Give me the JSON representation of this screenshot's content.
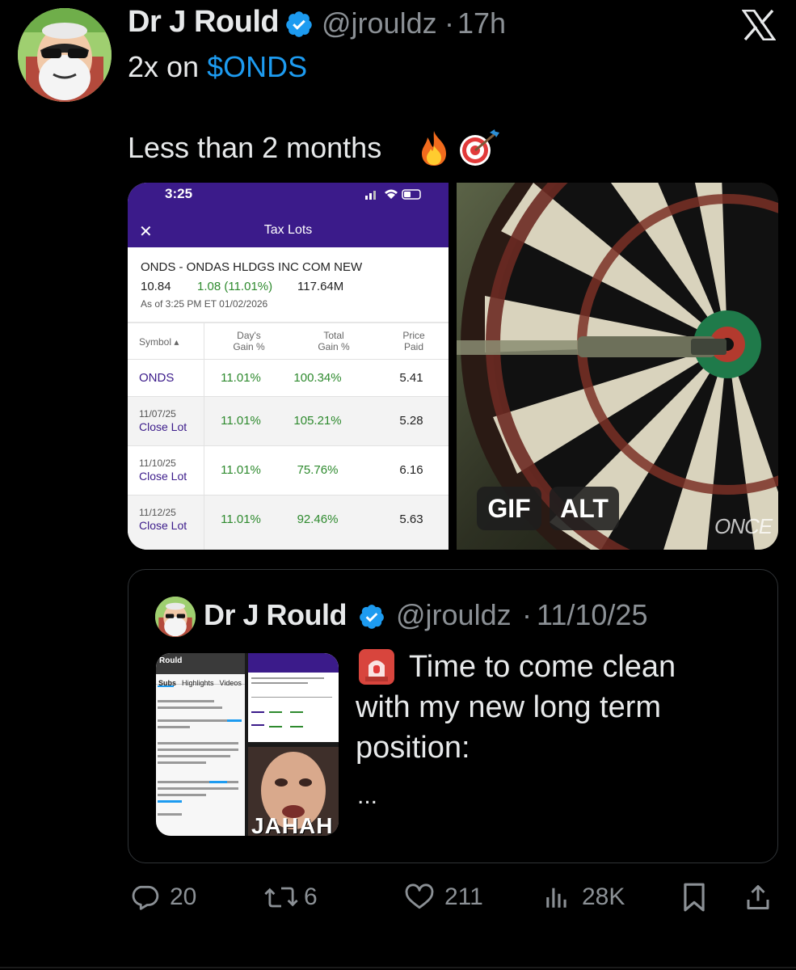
{
  "tweet": {
    "author_name": "Dr J Rould",
    "handle": "@jrouldz",
    "separator": "·",
    "time": "17h",
    "line1_prefix": "2x on ",
    "line1_cashtag": "$ONDS",
    "line2": "Less than 2 months"
  },
  "screenshot": {
    "status_time": "3:25",
    "title": "Tax Lots",
    "close_glyph": "✕",
    "security": "ONDS - ONDAS HLDGS INC COM NEW",
    "price": "10.84",
    "change": "1.08 (11.01%)",
    "volume": "117.64M",
    "as_of": "As of 3:25 PM ET 01/02/2026",
    "headers": {
      "symbol": "Symbol ▴",
      "days_gain_1": "Day's",
      "days_gain_2": "Gain %",
      "total_gain_1": "Total",
      "total_gain_2": "Gain %",
      "price_paid_1": "Price",
      "price_paid_2": "Paid"
    },
    "rows": [
      {
        "symbol": "ONDS",
        "day_gain": "11.01%",
        "total_gain": "100.34%",
        "price_paid": "5.41"
      },
      {
        "date": "11/07/25",
        "action": "Close Lot",
        "day_gain": "11.01%",
        "total_gain": "105.21%",
        "price_paid": "5.28"
      },
      {
        "date": "11/10/25",
        "action": "Close Lot",
        "day_gain": "11.01%",
        "total_gain": "75.76%",
        "price_paid": "6.16"
      },
      {
        "date": "11/12/25",
        "action": "Close Lot",
        "day_gain": "11.01%",
        "total_gain": "92.46%",
        "price_paid": "5.63"
      }
    ]
  },
  "gif": {
    "gif_label": "GIF",
    "alt_label": "ALT",
    "watermark": "ONCE"
  },
  "quoted": {
    "author_name": "Dr J Rould",
    "handle": "@jrouldz",
    "separator": "·",
    "date": "11/10/25",
    "text": "Time to come clean with my new long term position:",
    "ellipsis": "...",
    "thumb_caption": "JAHAH",
    "thumb_profile_name": "Rould",
    "thumb_tabs": [
      "Subs",
      "Highlights",
      "Videos"
    ]
  },
  "actions": {
    "replies": "20",
    "reposts": "6",
    "likes": "211",
    "views": "28K"
  },
  "colors": {
    "link": "#1d9bf0",
    "muted": "#8b9095",
    "app_purple": "#3b1b8a",
    "gain_green": "#2e8a2e"
  }
}
